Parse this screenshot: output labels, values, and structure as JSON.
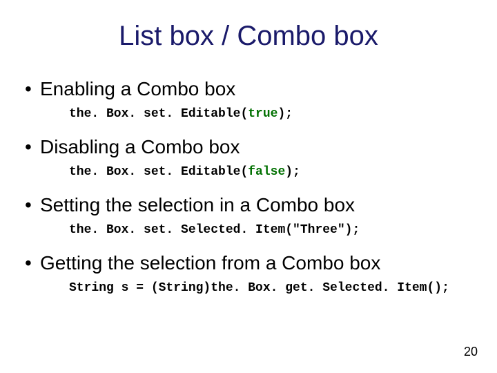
{
  "title": "List box / Combo box",
  "items": [
    {
      "heading": "Enabling a Combo box",
      "code_pre": "the. Box. set. Editable(",
      "code_kw": "true",
      "code_post": ");"
    },
    {
      "heading": "Disabling a Combo box",
      "code_pre": "the. Box. set. Editable(",
      "code_kw": "false",
      "code_post": ");"
    },
    {
      "heading": "Setting the selection in a Combo box",
      "code_pre": "the. Box. set. Selected. Item(\"Three\");",
      "code_kw": "",
      "code_post": ""
    },
    {
      "heading": "Getting the selection from a Combo box",
      "code_pre": "String s = (String)the. Box. get. Selected. Item();",
      "code_kw": "",
      "code_post": ""
    }
  ],
  "page_number": "20"
}
